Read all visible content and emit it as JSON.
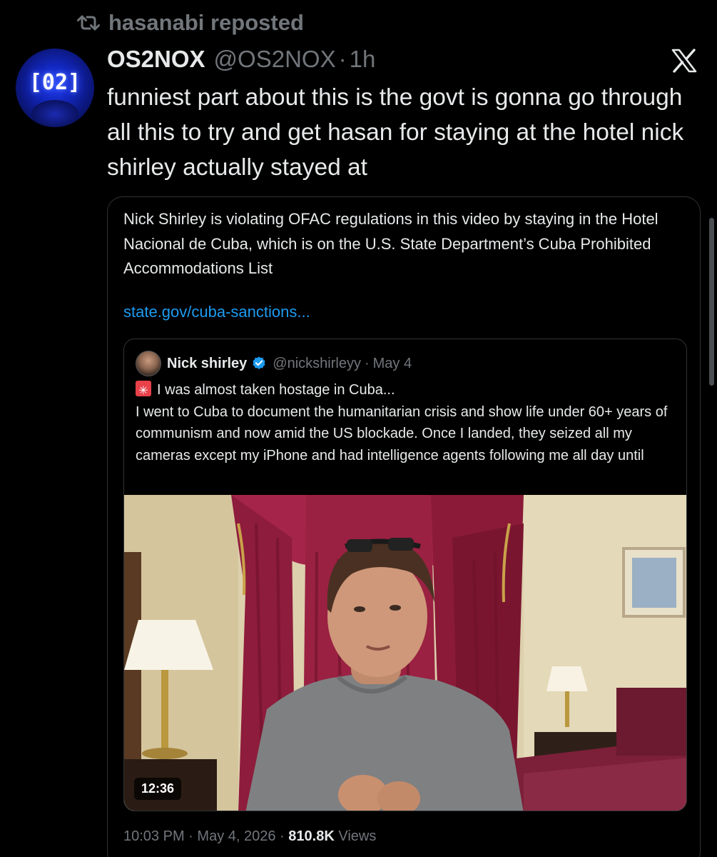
{
  "repost": {
    "text": "hasanabi reposted",
    "icon": "repost-icon"
  },
  "post": {
    "avatar_text": "[02]",
    "display_name": "OS2NOX",
    "handle": "@OS2NOX",
    "separator": "·",
    "time": "1h",
    "text": "funniest part about this is the govt is gonna go through all this to try and get hasan for staying at the hotel nick shirley actually stayed at",
    "brand_icon": "x-logo-icon"
  },
  "quote": {
    "text": "Nick Shirley is violating OFAC regulations in this video by staying in the Hotel Nacional de Cuba, which is on the U.S. State Department’s Cuba Prohibited Accommodations List",
    "link": "state.gov/cuba-sanctions...",
    "embedded": {
      "name": "Nick shirley",
      "handle": "@nickshirleyy",
      "separator": "·",
      "date": "May 4",
      "verified": true,
      "headline": "I was almost taken hostage in Cuba...",
      "body": "I went to Cuba to document the humanitarian crisis and show life under 60+ years of communism and now amid the US blockade. Once I landed, they seized all my cameras except my iPhone and had intelligence agents following me all day until",
      "video_duration": "12:36"
    },
    "footer": {
      "time": "10:03 PM",
      "sep1": "·",
      "date": "May 4, 2026",
      "sep2": "·",
      "views_count": "810.8K",
      "views_label": "Views"
    }
  },
  "colors": {
    "background": "#000000",
    "text": "#e7e9ea",
    "muted": "#71767b",
    "link": "#1d9bf0",
    "verified": "#1d9bf0",
    "border": "#2f3336"
  }
}
